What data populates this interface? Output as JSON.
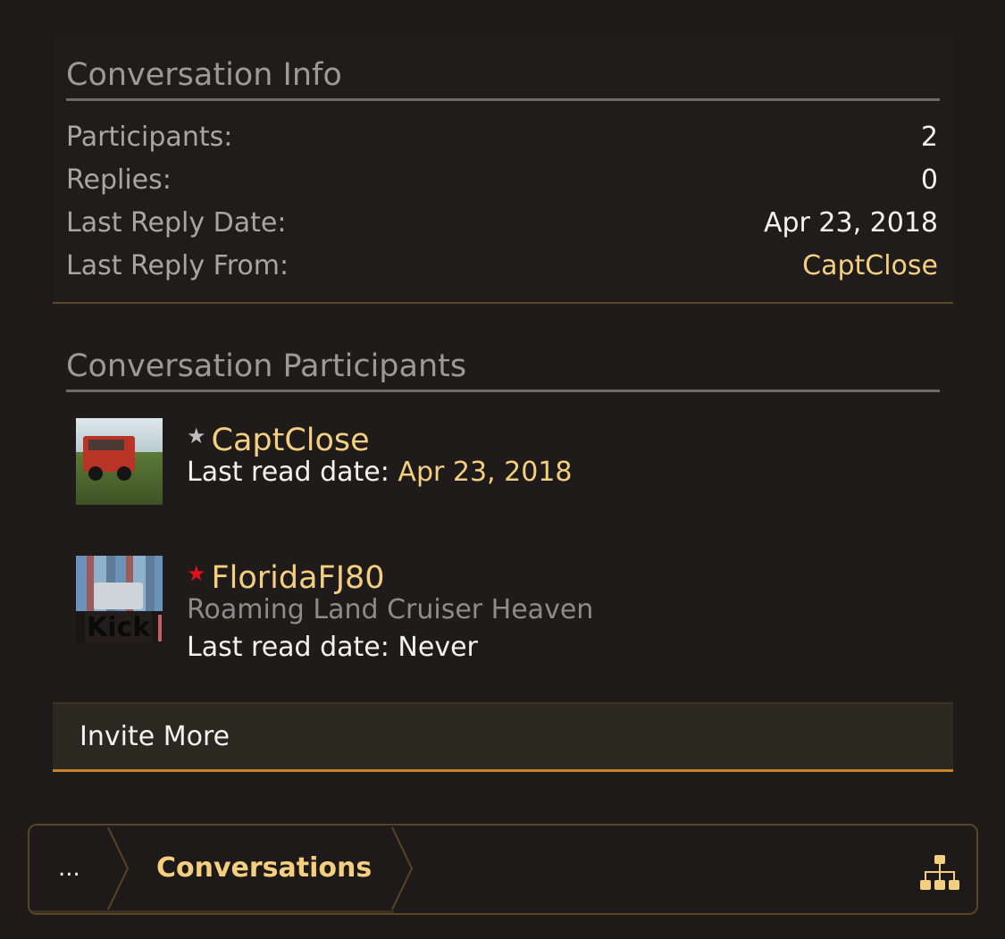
{
  "conversation_info": {
    "title": "Conversation Info",
    "rows": [
      {
        "label": "Participants:",
        "value": "2"
      },
      {
        "label": "Replies:",
        "value": "0"
      },
      {
        "label": "Last Reply Date:",
        "value": "Apr 23, 2018"
      },
      {
        "label": "Last Reply From:",
        "value": "CaptClose"
      }
    ]
  },
  "participants": {
    "title": "Conversation Participants",
    "items": [
      {
        "name": "CaptClose",
        "star": "grey-star-icon",
        "last_read_label": "Last read date: ",
        "last_read_value": "Apr 23, 2018"
      },
      {
        "name": "FloridaFJ80",
        "star": "red-star-icon",
        "user_title": "Roaming Land Cruiser Heaven",
        "last_read_label": "Last read date: ",
        "last_read_value": "Never",
        "avatar_overlay": "Kick"
      }
    ],
    "invite_label": "Invite More"
  },
  "breadcrumb": {
    "more": "...",
    "current": "Conversations",
    "icon": "sitemap-icon"
  },
  "colors": {
    "background": "#1e1a1a",
    "accent": "#f5cf80",
    "invite_border": "#c3852e",
    "star_red": "#e3101a"
  }
}
